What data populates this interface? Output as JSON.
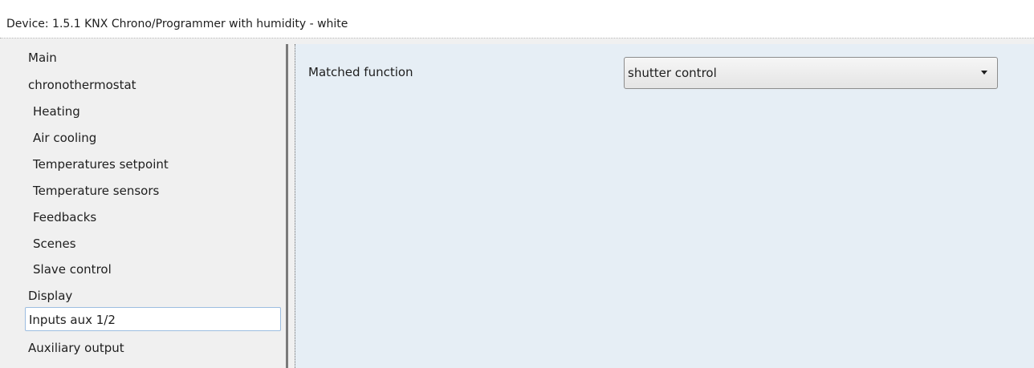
{
  "window": {
    "title": "Device: 1.5.1  KNX Chrono/Programmer with humidity - white"
  },
  "sidebar": {
    "items": [
      {
        "label": "Main"
      },
      {
        "label": "chronothermostat"
      },
      {
        "label": "Heating"
      },
      {
        "label": "Air cooling"
      },
      {
        "label": "Temperatures setpoint"
      },
      {
        "label": "Temperature sensors"
      },
      {
        "label": "Feedbacks"
      },
      {
        "label": "Scenes"
      },
      {
        "label": "Slave control"
      },
      {
        "label": "Display"
      },
      {
        "label": "Inputs aux 1/2",
        "selected": true
      },
      {
        "label": "Auxiliary output"
      }
    ]
  },
  "content": {
    "parameter_label": "Matched function",
    "dropdown": {
      "selected_value": "shutter control",
      "icon": "chevron-down-icon"
    }
  },
  "colors": {
    "content_background": "#e6eef5",
    "selection_border": "#9cbde0"
  }
}
